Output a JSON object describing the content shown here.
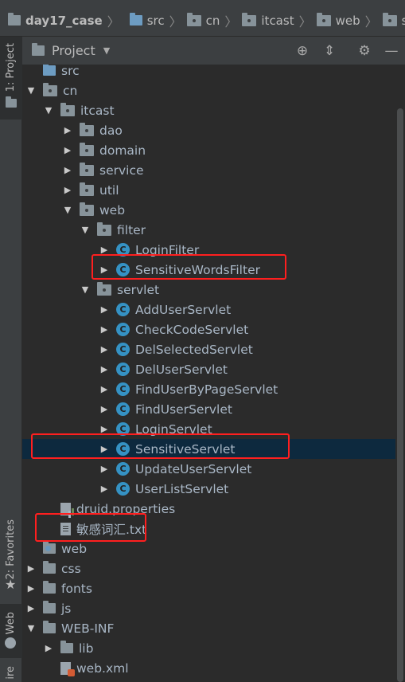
{
  "breadcrumb": [
    {
      "label": "day17_case",
      "icon": "project-folder-icon"
    },
    {
      "label": "src",
      "icon": "source-folder-icon"
    },
    {
      "label": "cn",
      "icon": "package-icon"
    },
    {
      "label": "itcast",
      "icon": "package-icon"
    },
    {
      "label": "web",
      "icon": "package-icon"
    },
    {
      "label": "servlet",
      "icon": "package-icon"
    }
  ],
  "sidebar": {
    "project_label": "1: Project",
    "favorites_label": "2: Favorites",
    "web_label": "Web",
    "structure_label": "ire"
  },
  "panel": {
    "title": "Project",
    "tools": [
      "target-icon",
      "collapse-icon",
      "gear-icon",
      "minimize-icon"
    ]
  },
  "tree": [
    {
      "label": "src",
      "level": 0,
      "arrow": "",
      "icon": "source-folder"
    },
    {
      "label": "cn",
      "level": 0,
      "arrow": "down",
      "icon": "package"
    },
    {
      "label": "itcast",
      "level": 1,
      "arrow": "down",
      "icon": "package"
    },
    {
      "label": "dao",
      "level": 2,
      "arrow": "right",
      "icon": "package"
    },
    {
      "label": "domain",
      "level": 2,
      "arrow": "right",
      "icon": "package"
    },
    {
      "label": "service",
      "level": 2,
      "arrow": "right",
      "icon": "package"
    },
    {
      "label": "util",
      "level": 2,
      "arrow": "right",
      "icon": "package"
    },
    {
      "label": "web",
      "level": 2,
      "arrow": "down",
      "icon": "package"
    },
    {
      "label": "filter",
      "level": 3,
      "arrow": "down",
      "icon": "package"
    },
    {
      "label": "LoginFilter",
      "level": 4,
      "arrow": "right",
      "icon": "class"
    },
    {
      "label": "SensitiveWordsFilter",
      "level": 4,
      "arrow": "right",
      "icon": "class"
    },
    {
      "label": "servlet",
      "level": 3,
      "arrow": "down",
      "icon": "package"
    },
    {
      "label": "AddUserServlet",
      "level": 4,
      "arrow": "right",
      "icon": "class"
    },
    {
      "label": "CheckCodeServlet",
      "level": 4,
      "arrow": "right",
      "icon": "class"
    },
    {
      "label": "DelSelectedServlet",
      "level": 4,
      "arrow": "right",
      "icon": "class"
    },
    {
      "label": "DelUserServlet",
      "level": 4,
      "arrow": "right",
      "icon": "class"
    },
    {
      "label": "FindUserByPageServlet",
      "level": 4,
      "arrow": "right",
      "icon": "class"
    },
    {
      "label": "FindUserServlet",
      "level": 4,
      "arrow": "right",
      "icon": "class"
    },
    {
      "label": "LoginServlet",
      "level": 4,
      "arrow": "right",
      "icon": "class"
    },
    {
      "label": "SensitiveServlet",
      "level": 4,
      "arrow": "right",
      "icon": "class",
      "selected": true
    },
    {
      "label": "UpdateUserServlet",
      "level": 4,
      "arrow": "right",
      "icon": "class"
    },
    {
      "label": "UserListServlet",
      "level": 4,
      "arrow": "right",
      "icon": "class"
    },
    {
      "label": "druid.properties",
      "level": 1,
      "arrow": "",
      "icon": "properties"
    },
    {
      "label": "敏感词汇.txt",
      "level": 1,
      "arrow": "",
      "icon": "text-file"
    },
    {
      "label": "web",
      "level": 0,
      "arrow": "",
      "icon": "web-folder"
    },
    {
      "label": "css",
      "level": 0,
      "arrow": "right",
      "icon": "folder"
    },
    {
      "label": "fonts",
      "level": 0,
      "arrow": "right",
      "icon": "folder"
    },
    {
      "label": "js",
      "level": 0,
      "arrow": "right",
      "icon": "folder"
    },
    {
      "label": "WEB-INF",
      "level": 0,
      "arrow": "down",
      "icon": "folder"
    },
    {
      "label": "lib",
      "level": 1,
      "arrow": "right",
      "icon": "folder"
    },
    {
      "label": "web.xml",
      "level": 1,
      "arrow": "",
      "icon": "xml"
    }
  ],
  "highlights": [
    "SensitiveWordsFilter",
    "SensitiveServlet",
    "敏感词汇.txt"
  ],
  "colors": {
    "selection": "#0d293e",
    "highlight": "#ff1f1f",
    "class_icon": "#3592c4"
  }
}
